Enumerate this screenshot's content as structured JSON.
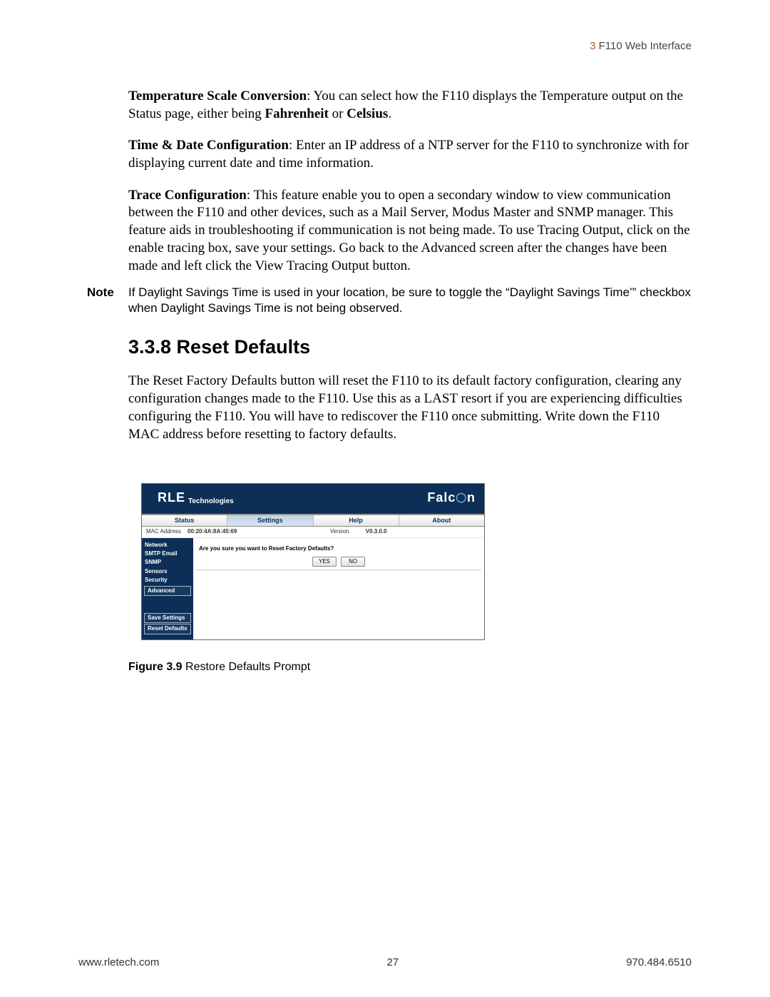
{
  "header": {
    "chapter_num": "3",
    "chapter_title": "F110 Web Interface"
  },
  "paragraphs": {
    "temp_bold": "Temperature Scale Conversion",
    "temp_rest_a": ": You can select how the F110 displays the Temperature output on the Status page, either being ",
    "temp_bold2": "Fahrenheit",
    "temp_or": " or ",
    "temp_bold3": "Celsius",
    "temp_end": ".",
    "time_bold": "Time & Date Configuration",
    "time_rest": ": Enter an IP address of a NTP server for the F110 to synchronize with for displaying current date and time information.",
    "trace_bold": "Trace Configuration",
    "trace_rest": ": This feature enable you to open a secondary window to view communication between the F110 and other devices, such as a Mail Server, Modus Master and SNMP manager. This feature aids in troubleshooting if communication is not being made. To use Tracing Output, click on the enable tracing box, save your settings. Go back to the Advanced screen after the changes have been made and left click the View Tracing Output button."
  },
  "note": {
    "label": "Note",
    "text": "If Daylight Savings Time is used in your location, be sure to toggle the “Daylight Savings Time’” checkbox when Daylight Savings Time is not being observed."
  },
  "section": {
    "heading": "3.3.8  Reset Defaults",
    "body": "The Reset Factory Defaults button will reset the F110 to its default factory configuration, clearing any configuration changes made to the F110. Use this as a LAST resort if you are experiencing difficulties configuring the F110. You will have to rediscover the F110 once submitting. Write down the F110 MAC address before resetting to factory defaults."
  },
  "figure": {
    "brand_left_main": "RLE",
    "brand_left_sub": "Technologies",
    "brand_right_a": "Falc",
    "brand_right_b": "n",
    "tabs": [
      "Status",
      "Settings",
      "Help",
      "About"
    ],
    "mac_label": "MAC Address",
    "mac_value": "00:20:4A:8A:45:69",
    "version_label": "Version",
    "version_value": "V0.3.0.0",
    "sidebar": [
      "Network",
      "SMTP Email",
      "SNMP",
      "Sensors",
      "Security",
      "Advanced"
    ],
    "sidebar_actions": [
      "Save Settings",
      "Reset Defaults"
    ],
    "prompt": "Are you sure you want to Reset Factory Defaults?",
    "yes": "YES",
    "no": "NO",
    "caption_bold": "Figure 3.9",
    "caption_rest": "Restore Defaults Prompt"
  },
  "footer": {
    "left": "www.rletech.com",
    "center": "27",
    "right": "970.484.6510"
  }
}
